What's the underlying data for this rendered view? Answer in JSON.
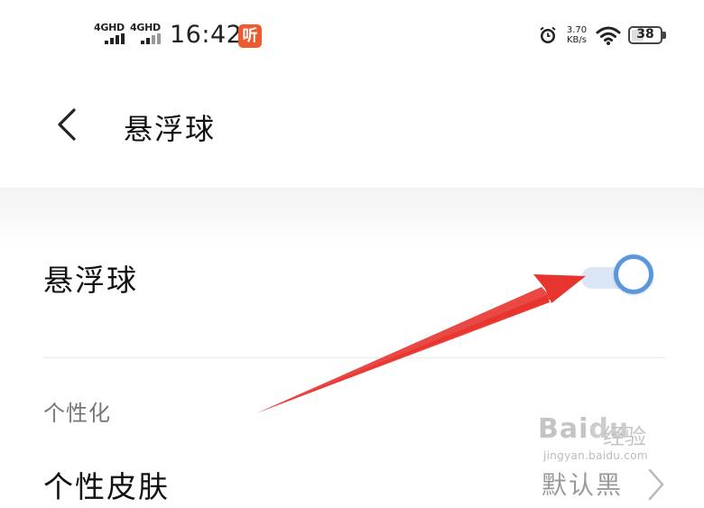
{
  "status_bar": {
    "signal_1_label": "4GHD",
    "signal_2_label": "4GHD",
    "time": "16:42",
    "app_badge": "听",
    "net_speed_value": "3.70",
    "net_speed_unit": "KB/s",
    "battery_level": "38",
    "icons": [
      "signal-icon",
      "alarm-icon",
      "wifi-icon",
      "battery-icon"
    ]
  },
  "header": {
    "back_icon": "back-chevron-icon",
    "title": "悬浮球"
  },
  "settings": {
    "floating_ball": {
      "label": "悬浮球",
      "enabled": true
    },
    "section_personalization": "个性化",
    "theme_row": {
      "label": "个性皮肤",
      "value": "默认黑"
    }
  },
  "annotation": {
    "arrow_color": "#e8342f"
  },
  "watermark": {
    "logo_part1": "Bai",
    "logo_part2": "du",
    "text": "经验",
    "url": "jingyan.baidu.com"
  },
  "colors": {
    "toggle_accent": "#5b97df",
    "toggle_track": "#dbe7f6",
    "app_badge": "#ee5b2f"
  }
}
